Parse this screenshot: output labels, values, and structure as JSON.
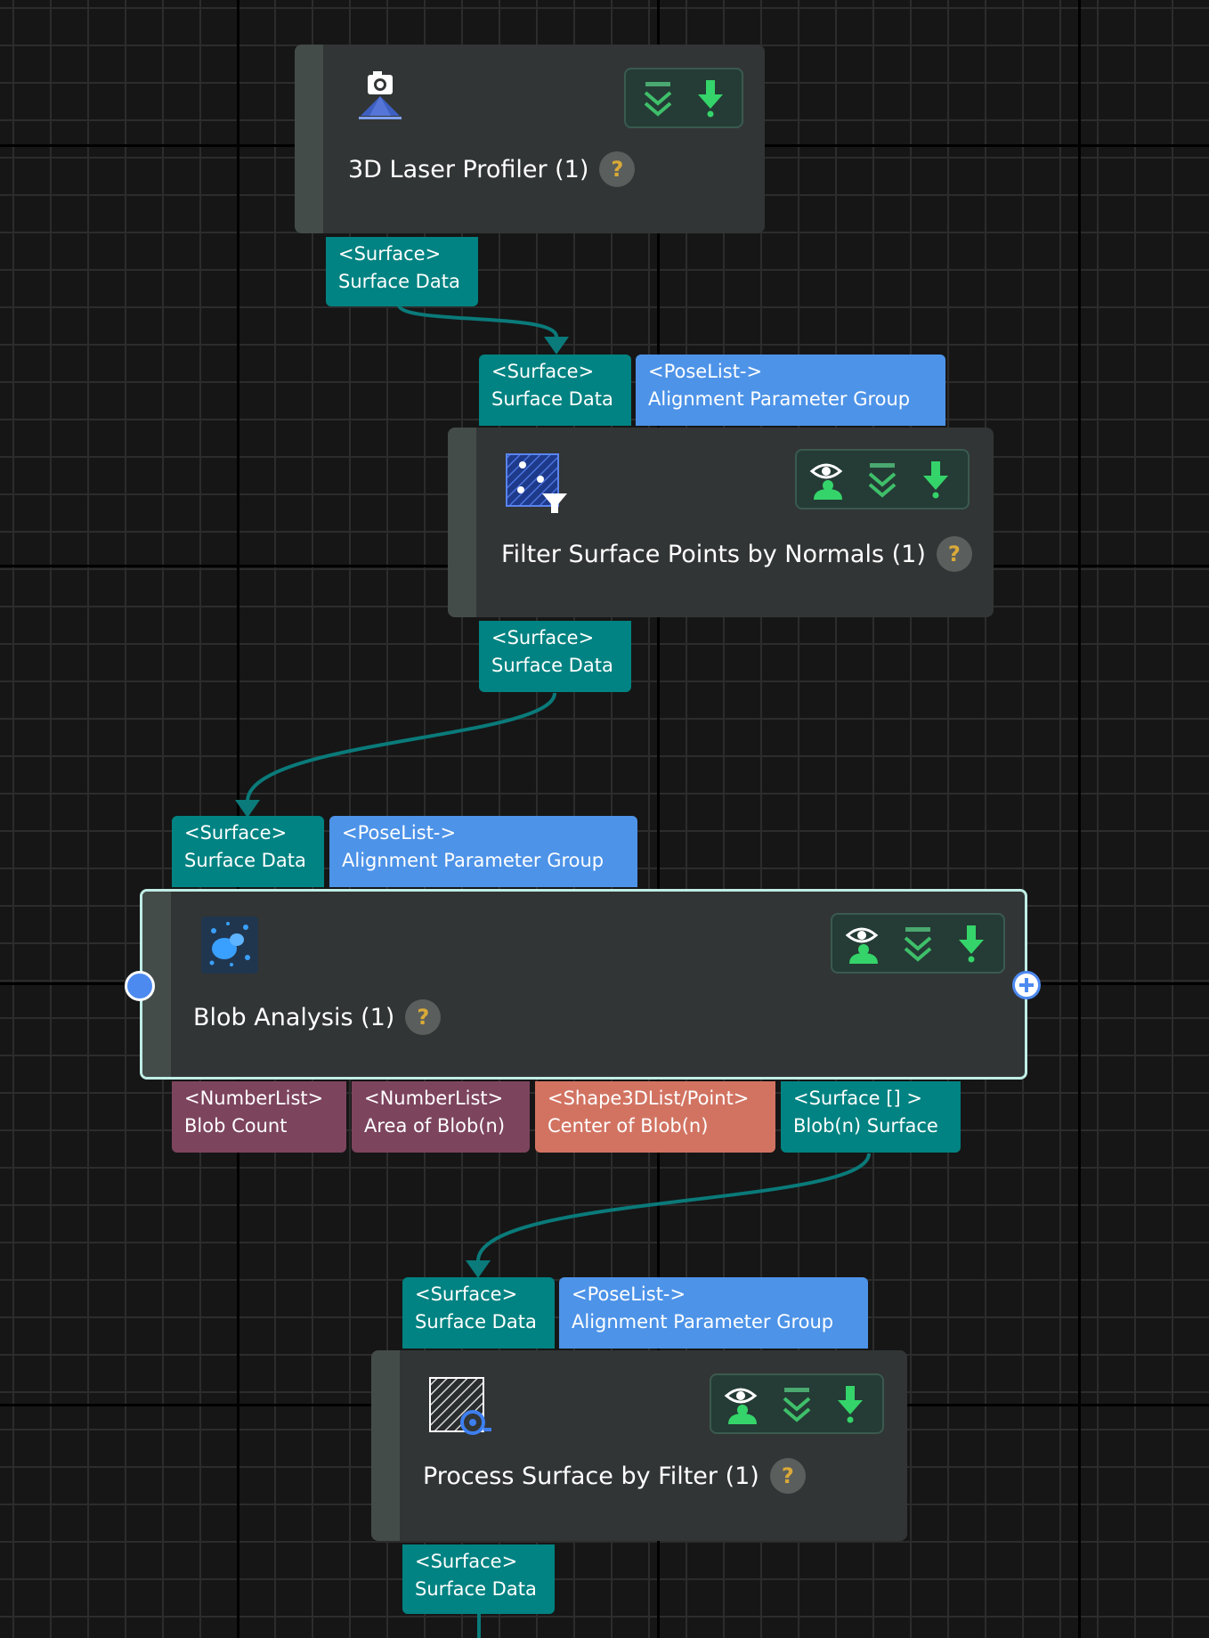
{
  "nodes": {
    "laser_profiler": {
      "title": "3D Laser Profiler (1)",
      "help": "?",
      "icon": "camera-icon",
      "outputs": [
        {
          "type": "<Surface>",
          "name": "Surface Data"
        }
      ]
    },
    "filter_normals": {
      "title": "Filter Surface Points by Normals (1)",
      "help": "?",
      "icon": "filter-points-icon",
      "inputs": [
        {
          "type": "<Surface>",
          "name": "Surface Data"
        },
        {
          "type": "<PoseList->",
          "name": "Alignment Parameter Group"
        }
      ],
      "outputs": [
        {
          "type": "<Surface>",
          "name": "Surface Data"
        }
      ]
    },
    "blob_analysis": {
      "title": "Blob Analysis (1)",
      "help": "?",
      "icon": "blob-icon",
      "inputs": [
        {
          "type": "<Surface>",
          "name": "Surface Data"
        },
        {
          "type": "<PoseList->",
          "name": "Alignment Parameter Group"
        }
      ],
      "outputs": [
        {
          "type": "<NumberList>",
          "name": "Blob Count"
        },
        {
          "type": "<NumberList>",
          "name": "Area of Blob(n)"
        },
        {
          "type": "<Shape3DList/Point>",
          "name": "Center of Blob(n)"
        },
        {
          "type": "<Surface [] >",
          "name": "Blob(n) Surface"
        }
      ]
    },
    "process_filter": {
      "title": "Process Surface by Filter (1)",
      "help": "?",
      "icon": "process-surface-icon",
      "inputs": [
        {
          "type": "<Surface>",
          "name": "Surface Data"
        },
        {
          "type": "<PoseList->",
          "name": "Alignment Parameter Group"
        }
      ],
      "outputs": [
        {
          "type": "<Surface>",
          "name": "Surface Data"
        }
      ]
    }
  },
  "colors": {
    "surface_port": "#008382",
    "pose_port": "#4d93e8",
    "number_port": "#7d445e",
    "shape_port": "#d27362",
    "connector": "#0a7a7a",
    "selected_outline": "#bfeee5"
  },
  "toolbar_icons": [
    "show-result-icon",
    "collapse-icon",
    "download-icon"
  ]
}
